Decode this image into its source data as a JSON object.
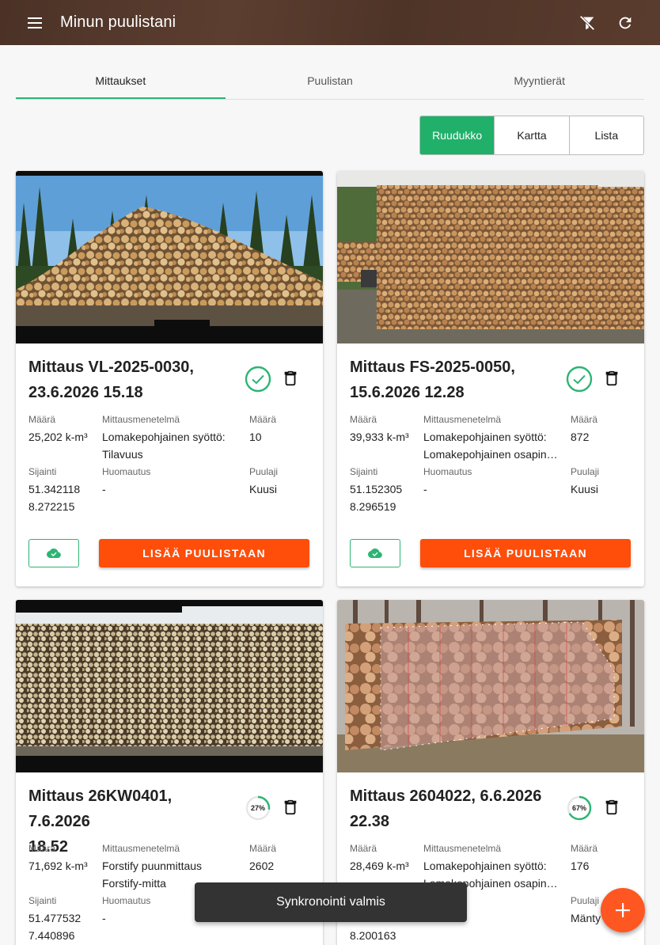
{
  "appbar": {
    "title": "Minun puulistani",
    "menu_icon": "menu-icon",
    "filter_off_icon": "filter-off-icon",
    "refresh_icon": "refresh-icon"
  },
  "tabs": [
    {
      "label": "Mittaukset",
      "active": true
    },
    {
      "label": "Puulistan",
      "active": false
    },
    {
      "label": "Myyntierät",
      "active": false
    }
  ],
  "view_toggle": [
    {
      "label": "Ruudukko",
      "active": true
    },
    {
      "label": "Kartta",
      "active": false
    },
    {
      "label": "Lista",
      "active": false
    }
  ],
  "labels": {
    "maara": "Määrä",
    "menetelma": "Mittausmenetelmä",
    "sijainti": "Sijainti",
    "huomautus": "Huomautus",
    "puulaji": "Puulaji",
    "add_button": "LISÄÄ PUULISTAAN"
  },
  "cards": [
    {
      "title_line1": "Mittaus VL-2025-0030,",
      "title_line2": "23.6.2026 15.18",
      "status": "done",
      "volume": "25,202 k-m³",
      "method_line1": "Lomakepohjainen syöttö:",
      "method_line2": "Tilavuus",
      "count": "10",
      "lat": "51.342118",
      "lon": "8.272215",
      "note": "-",
      "species": "Kuusi"
    },
    {
      "title_line1": "Mittaus FS-2025-0050,",
      "title_line2": "15.6.2026 12.28",
      "status": "done",
      "volume": "39,933 k-m³",
      "method_line1": "Lomakepohjainen syöttö:",
      "method_line2": "Lomakepohjainen osapin…",
      "count": "872",
      "lat": "51.152305",
      "lon": "8.296519",
      "note": "-",
      "species": "Kuusi"
    },
    {
      "title_line1": "Mittaus 26KW0401, 7.6.2026",
      "title_line2": "18.52",
      "status": "progress",
      "progress_label": "27%",
      "progress": 0.27,
      "volume": "71,692 k-m³",
      "method_line1": "Forstify puunmittaus",
      "method_line2": "Forstify-mitta",
      "count": "2602",
      "lat": "51.477532",
      "lon": "7.440896",
      "note": "-",
      "species": ""
    },
    {
      "title_line1": "Mittaus 2604022, 6.6.2026",
      "title_line2": "22.38",
      "status": "progress",
      "progress_label": "67%",
      "progress": 0.67,
      "volume": "28,469 k-m³",
      "method_line1": "Lomakepohjainen syöttö:",
      "method_line2": "Lomakepohjainen osapin…",
      "count": "176",
      "lat": "",
      "lon": "8.200163",
      "note": "",
      "species": "Mänty"
    }
  ],
  "snackbar": {
    "text": "Synkronointi valmis"
  },
  "fab": {
    "icon": "plus-icon"
  },
  "colors": {
    "accent": "#2bb573",
    "primary_button": "#ff4d0a",
    "appbar": "#4e3427",
    "fab": "#ff5722"
  }
}
